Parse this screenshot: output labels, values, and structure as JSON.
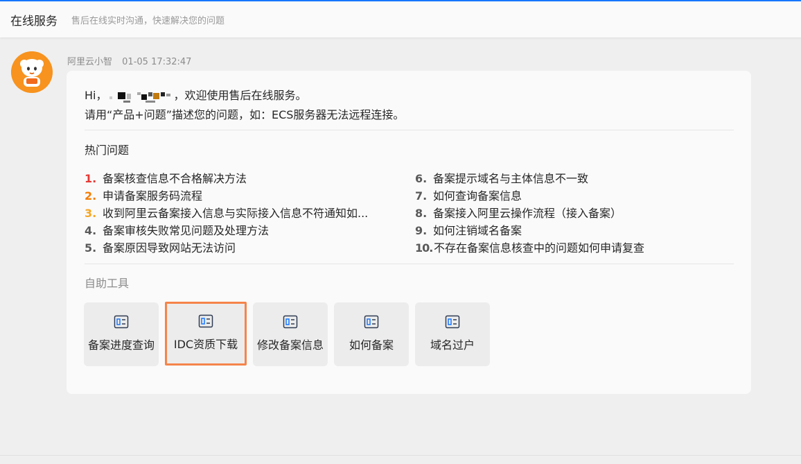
{
  "header": {
    "title": "在线服务",
    "subtitle": "售后在线实时沟通，快速解决您的问题"
  },
  "message": {
    "sender": "阿里云小智",
    "time": "01-05 17:32:47",
    "greeting_prefix": "Hi，",
    "greeting_suffix": "，欢迎使用售后在线服务。",
    "instruction": "请用“产品+问题”描述您的问题，如：ECS服务器无法远程连接。",
    "hot_title": "热门问题",
    "tools_title": "自助工具"
  },
  "hot_questions": [
    {
      "num": "1.",
      "text": "备案核查信息不合格解决方法",
      "color": "#e53935"
    },
    {
      "num": "2.",
      "text": "申请备案服务码流程",
      "color": "#f57c00"
    },
    {
      "num": "3.",
      "text": "收到阿里云备案接入信息与实际接入信息不符通知如...",
      "color": "#f5a623"
    },
    {
      "num": "4.",
      "text": "备案审核失败常见问题及处理方法",
      "color": "#595959"
    },
    {
      "num": "5.",
      "text": "备案原因导致网站无法访问",
      "color": "#595959"
    },
    {
      "num": "6.",
      "text": "备案提示域名与主体信息不一致",
      "color": "#595959"
    },
    {
      "num": "7.",
      "text": "如何查询备案信息",
      "color": "#595959"
    },
    {
      "num": "8.",
      "text": "备案接入阿里云操作流程（接入备案）",
      "color": "#595959"
    },
    {
      "num": "9.",
      "text": "如何注销域名备案",
      "color": "#595959"
    },
    {
      "num": "10.",
      "text": "不存在备案信息核查中的问题如何申请复查",
      "color": "#595959"
    }
  ],
  "tools": [
    {
      "label": "备案进度查询",
      "icon": "form-icon"
    },
    {
      "label": "IDC资质下载",
      "icon": "form-icon"
    },
    {
      "label": "修改备案信息",
      "icon": "form-icon"
    },
    {
      "label": "如何备案",
      "icon": "form-icon"
    },
    {
      "label": "域名过户",
      "icon": "form-icon"
    }
  ],
  "colors": {
    "accent": "#1677ff",
    "highlight": "#f5844a",
    "avatar": "#f7931e"
  }
}
